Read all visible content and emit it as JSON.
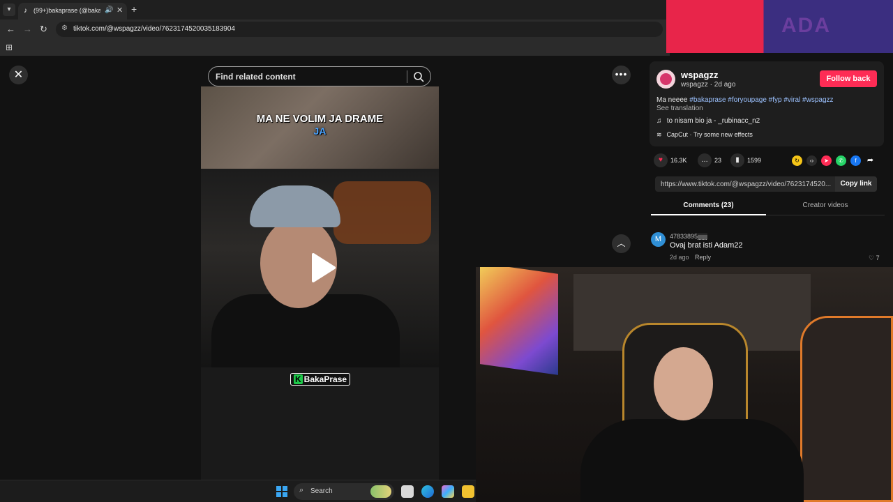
{
  "browser": {
    "tab_title": "(99+)bakaprase (@bakapra",
    "url": "tiktok.com/@wspagzz/video/7623174520035183904"
  },
  "video": {
    "search_placeholder": "Find related content",
    "caption_line1": "MA NE VOLIM JA DRAME",
    "caption_line2": "JA",
    "brand_tag": "BakaPrase"
  },
  "creator": {
    "username": "wspagzz",
    "handle": "wspagzz",
    "time": "2d ago",
    "follow_label": "Follow back",
    "desc_prefix": "Ma neeee",
    "hashtags": "#bakaprase #foryoupage #fyp #viral #wspagzz",
    "see_translation": "See translation",
    "music": "to nisam bio ja - _rubinacc_n2",
    "capcut": "CapCut · Try some new effects"
  },
  "stats": {
    "likes": "16.3K",
    "comments": "23",
    "saves": "1599"
  },
  "share": {
    "link": "https://www.tiktok.com/@wspagzz/video/7623174520...",
    "copy_label": "Copy link"
  },
  "tabs": {
    "comments": "Comments (23)",
    "creator_videos": "Creator videos"
  },
  "comments": [
    {
      "avatar_letter": "M",
      "user": "47833895jjjjjjj",
      "text": "Ovaj brat isti Adam22",
      "date": "2d ago",
      "reply": "Reply",
      "likes": "7"
    }
  ],
  "taskbar": {
    "search_label": "Search"
  },
  "colors": {
    "follow": "#fe2c55",
    "hashtag": "#9cc2ff"
  }
}
